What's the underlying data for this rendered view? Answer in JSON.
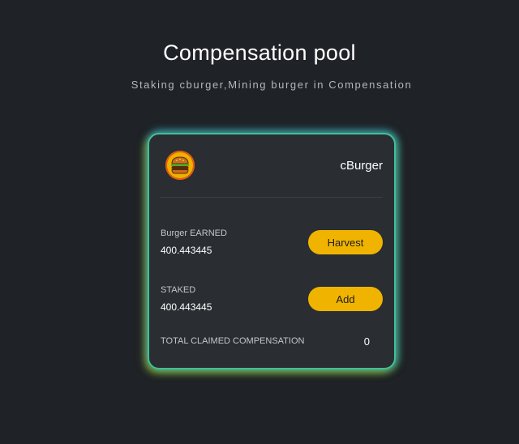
{
  "header": {
    "title": "Compensation pool",
    "subtitle": "Staking cburger,Mining burger in Compensation"
  },
  "card": {
    "token_icon": "burger-icon",
    "token_name": "cBurger",
    "earned": {
      "label": "Burger EARNED",
      "value": "400.443445",
      "button_label": "Harvest"
    },
    "staked": {
      "label": "STAKED",
      "value": "400.443445",
      "button_label": "Add"
    },
    "total_claimed": {
      "label": "TOTAL CLAIMED COMPENSATION",
      "value": "0"
    }
  },
  "colors": {
    "background": "#1f2226",
    "card": "#2a2e33",
    "accent_button": "#f0b400",
    "glow_top": "#3cb4dc",
    "glow_bottom_left": "#aac83c"
  }
}
